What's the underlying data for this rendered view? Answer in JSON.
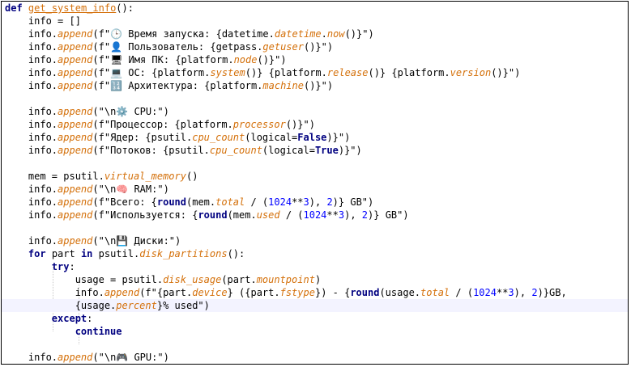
{
  "code_lines": [
    {
      "t": "def get_system_info():"
    },
    {
      "t": "    info = []"
    },
    {
      "t": "    info.append(f\"🕒 Время запуска: {datetime.datetime.now()}\")"
    },
    {
      "t": "    info.append(f\"👤 Пользователь: {getpass.getuser()}\")"
    },
    {
      "t": "    info.append(f\"🖥 Имя ПК: {platform.node()}\")"
    },
    {
      "t": "    info.append(f\"💻 ОС: {platform.system()} {platform.release()} {platform.version()}\")"
    },
    {
      "t": "    info.append(f\"🔢 Архитектура: {platform.machine()}\")"
    },
    {
      "t": ""
    },
    {
      "t": "    info.append(\"\\n⚙️ CPU:\")"
    },
    {
      "t": "    info.append(f\"Процессор: {platform.processor()}\")"
    },
    {
      "t": "    info.append(f\"Ядер: {psutil.cpu_count(logical=False)}\")"
    },
    {
      "t": "    info.append(f\"Потоков: {psutil.cpu_count(logical=True)}\")"
    },
    {
      "t": ""
    },
    {
      "t": "    mem = psutil.virtual_memory()"
    },
    {
      "t": "    info.append(\"\\n🧠 RAM:\")"
    },
    {
      "t": "    info.append(f\"Всего: {round(mem.total / (1024**3), 2)} GB\")"
    },
    {
      "t": "    info.append(f\"Используется: {round(mem.used / (1024**3), 2)} GB\")"
    },
    {
      "t": ""
    },
    {
      "t": "    info.append(\"\\n💾 Диски:\")"
    },
    {
      "t": "    for part in psutil.disk_partitions():"
    },
    {
      "t": "        try:"
    },
    {
      "t": "            usage = psutil.disk_usage(part.mountpoint)"
    },
    {
      "t": "            info.append(f\"{part.device} ({part.fstype}) - {round(usage.total / (1024**3), 2)}GB,"
    },
    {
      "t": "            {usage.percent}% used\")"
    },
    {
      "t": "        except:"
    },
    {
      "t": "            continue"
    },
    {
      "t": ""
    },
    {
      "t": "    info.append(\"\\n🎮 GPU:\")"
    }
  ],
  "highlighted_line_index": 23,
  "colors": {
    "keyword": "#000080",
    "method": "#d4700a",
    "number": "#0000ff",
    "highlight": "#f3f3ff"
  }
}
